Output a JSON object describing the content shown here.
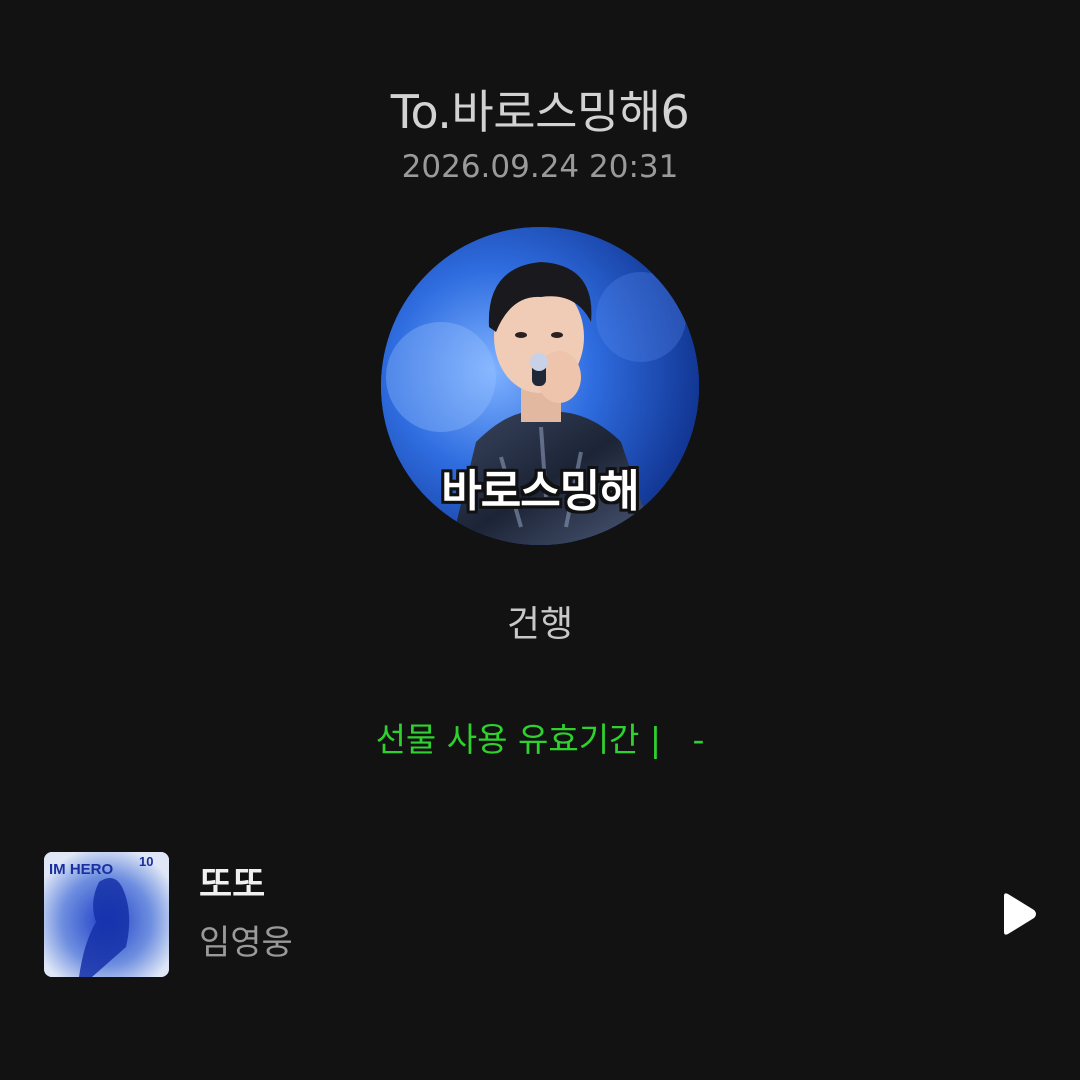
{
  "header": {
    "title": "To.바로스밍해6",
    "timestamp": "2026.09.24 20:31"
  },
  "profile": {
    "image_caption": "바로스밍해",
    "sender": "건행"
  },
  "gift": {
    "validity_label": "선물 사용 유효기간 |   -"
  },
  "track": {
    "title": "또또",
    "artist": "임영웅",
    "album_art_text": "IM HERO",
    "album_art_number": "10",
    "icon": "play-icon"
  },
  "colors": {
    "background": "#121212",
    "accent_green": "#2fd12f"
  }
}
